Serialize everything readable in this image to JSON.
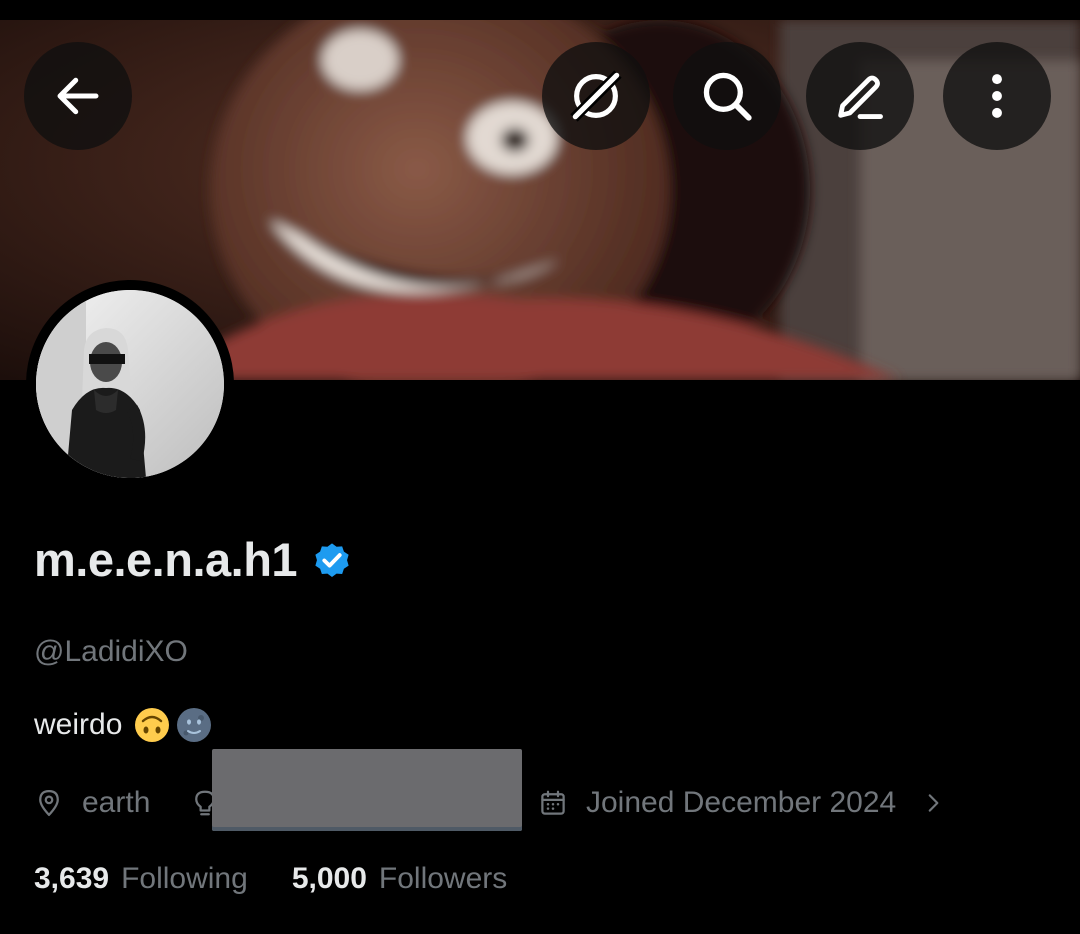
{
  "header": {
    "back_icon": "arrow-left-icon",
    "grok_icon": "grok-icon",
    "search_icon": "search-icon",
    "edit_icon": "pencil-icon",
    "more_icon": "more-vertical-icon"
  },
  "profile": {
    "display_name": "m.e.e.n.a.h1",
    "verified": true,
    "handle": "@LadidiXO",
    "bio_text": "weirdo",
    "bio_emojis": [
      "upside-down-face-emoji",
      "new-moon-face-emoji"
    ],
    "location": "earth",
    "joined": "Joined December 2024"
  },
  "stats": {
    "following_count": "3,639",
    "following_label": "Following",
    "followers_count": "5,000",
    "followers_label": "Followers"
  },
  "colors": {
    "background": "#000000",
    "primary_text": "#e7e9ea",
    "secondary_text": "#71767b",
    "verified_blue": "#1d9bf0"
  }
}
